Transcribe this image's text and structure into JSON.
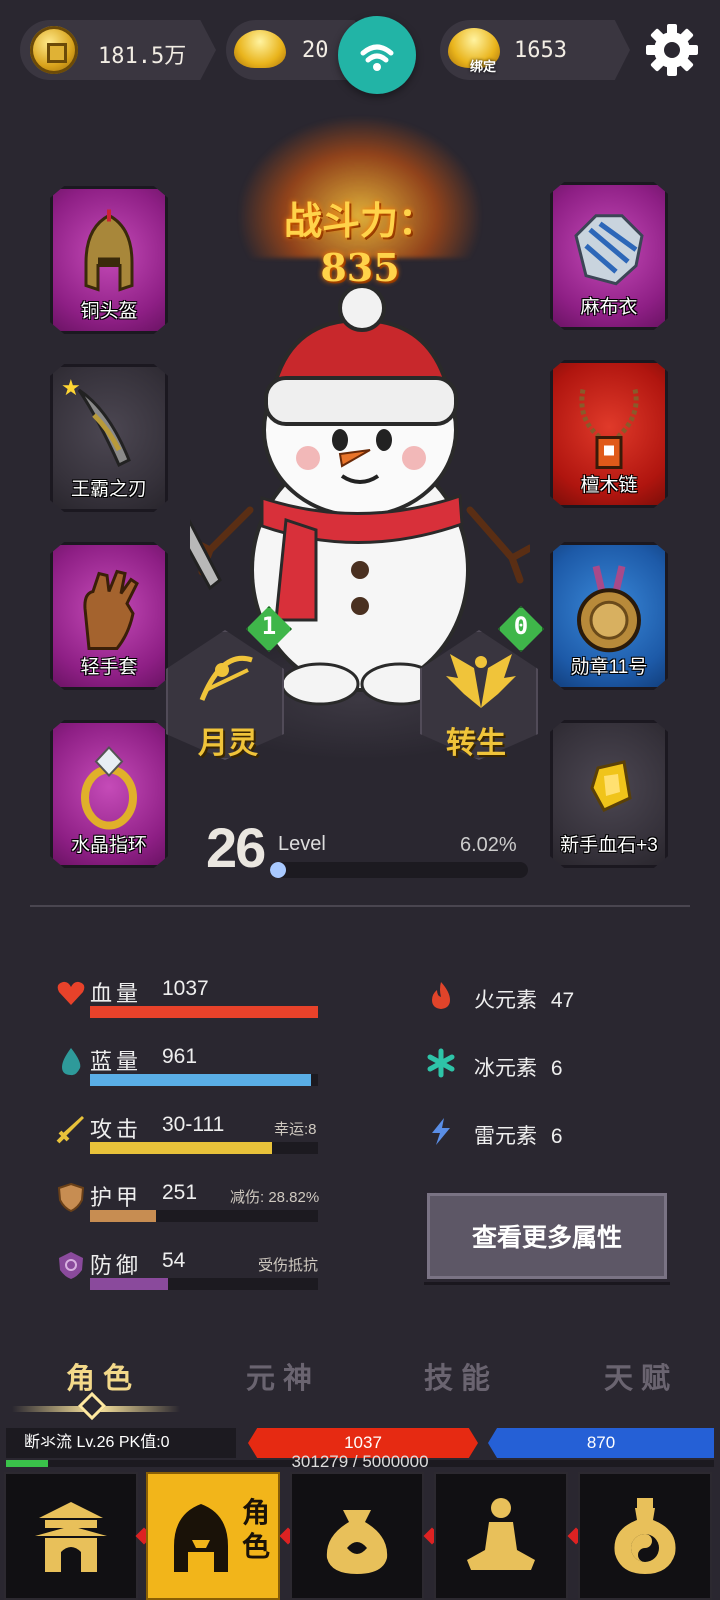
{
  "currency": {
    "copper": "181.5万",
    "gold": "20",
    "bound_gold": "1653",
    "bound_tag": "绑定"
  },
  "combat_power": "战斗力：835",
  "equipment": {
    "left": [
      {
        "label": "铜头盔",
        "rarity": "purple",
        "icon": "helmet-icon"
      },
      {
        "label": "王霸之刃",
        "rarity": "gray",
        "icon": "sword-icon"
      },
      {
        "label": "轻手套",
        "rarity": "purple",
        "icon": "glove-icon"
      },
      {
        "label": "水晶指环",
        "rarity": "purple",
        "icon": "ring-icon"
      }
    ],
    "right": [
      {
        "label": "麻布衣",
        "rarity": "purple",
        "icon": "armor-icon"
      },
      {
        "label": "檀木链",
        "rarity": "red",
        "icon": "necklace-icon"
      },
      {
        "label": "勋章11号",
        "rarity": "blue",
        "icon": "medal-icon"
      },
      {
        "label": "新手血石+3",
        "rarity": "gray",
        "icon": "bloodstone-icon"
      }
    ]
  },
  "spirit": {
    "label": "月灵",
    "count": "1"
  },
  "rebirth": {
    "label": "转生",
    "count": "0"
  },
  "level": {
    "number": "26",
    "word": "Level",
    "percent": "6.02%",
    "progress": 0.0602
  },
  "stats": [
    {
      "name": "血量",
      "value": "1037",
      "extra": "",
      "color": "#e8422a",
      "fill": 1.0,
      "icon": "heart-icon"
    },
    {
      "name": "蓝量",
      "value": "961",
      "extra": "",
      "color": "#5aaee6",
      "fill": 0.97,
      "icon": "drop-icon"
    },
    {
      "name": "攻击",
      "value": "30-111",
      "extra": "幸运:8",
      "color": "#e8c23a",
      "fill": 0.8,
      "icon": "attack-sword-icon"
    },
    {
      "name": "护甲",
      "value": "251",
      "extra": "减伤: 28.82%",
      "color": "#c78d52",
      "fill": 0.29,
      "icon": "shield-icon"
    },
    {
      "name": "防御",
      "value": "54",
      "extra": "受伤抵抗",
      "color": "#8a4a9c",
      "fill": 0.34,
      "icon": "defense-icon"
    }
  ],
  "elements": [
    {
      "name": "火元素",
      "value": "47",
      "color": "#e0442a",
      "icon": "fire-icon"
    },
    {
      "name": "冰元素",
      "value": "6",
      "color": "#2ec4a8",
      "icon": "ice-icon"
    },
    {
      "name": "雷元素",
      "value": "6",
      "color": "#5a8ee6",
      "icon": "lightning-icon"
    }
  ],
  "more_button": "查看更多属性",
  "tabs": [
    "角色",
    "元神",
    "技能",
    "天赋"
  ],
  "status": {
    "name_level": "断氺流  Lv.26  PK值:0",
    "hp": "1037",
    "mp": "870",
    "exp": "301279  /  5000000",
    "exp_progress": 0.06
  },
  "nav": [
    {
      "name": "town",
      "label": "",
      "icon": "gate-icon"
    },
    {
      "name": "character",
      "label": "角色",
      "icon": "helmet-nav-icon"
    },
    {
      "name": "bag",
      "label": "",
      "icon": "bag-icon"
    },
    {
      "name": "meditate",
      "label": "",
      "icon": "meditate-icon"
    },
    {
      "name": "alchemy",
      "label": "",
      "icon": "gourd-icon"
    }
  ]
}
